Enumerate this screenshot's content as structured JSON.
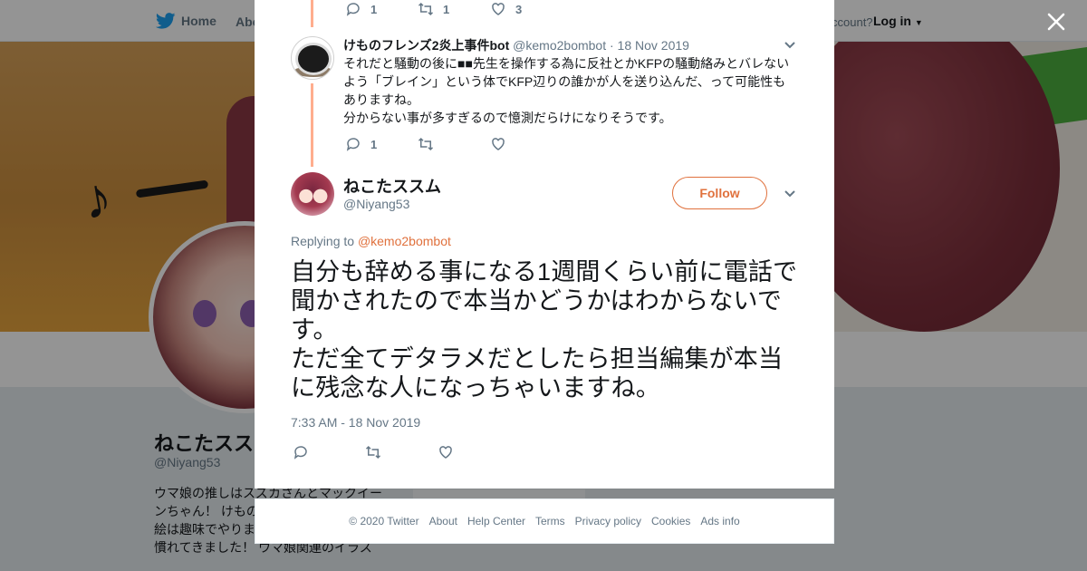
{
  "nav": {
    "home": "Home",
    "about": "Abo",
    "account": "ccount?",
    "login": "Log in"
  },
  "profile": {
    "name": "ねこたスス",
    "handle": "@Niyang53",
    "bio": "ウマ娘の推しはスズカさんとマックイーンちゃん！ けもの ン。元イラストレ め絵は趣味でやります。大分現在の仕事に慣れてきました！ ウマ娘関連のイラス"
  },
  "thread": {
    "top_actions": {
      "reply_count": "1",
      "retweet_count": "1",
      "like_count": "3"
    },
    "reply": {
      "name": "けものフレンズ2炎上事件bot",
      "handle": "@kemo2bombot",
      "date": "· 18 Nov 2019",
      "text": "それだと騒動の後に■■先生を操作する為に反社とかKFPの騒動絡みとバレないよう「ブレイン」という体でKFP辺りの誰かが人を送り込んだ、って可能性もありますね。\n分からない事が多すぎるので憶測だらけになりそうです。",
      "reply_count": "1",
      "retweet_count": "",
      "like_count": ""
    },
    "main": {
      "name": "ねこたススム",
      "handle": "@Niyang53",
      "follow_label": "Follow",
      "replying_label": "Replying to",
      "replying_to": "@kemo2bombot",
      "text": "自分も辞める事になる1週間くらい前に電話で聞かされたので本当かどうかはわからないです。\nただ全てデタラメだとしたら担当編集が本当に残念な人になっちゃいますね。",
      "timestamp": "7:33 AM - 18 Nov 2019"
    }
  },
  "footer": {
    "copyright": "© 2020 Twitter",
    "links": [
      "About",
      "Help Center",
      "Terms",
      "Privacy policy",
      "Cookies",
      "Ads info"
    ]
  },
  "colors": {
    "accent": "#e0713d",
    "thread_line": "#ffad8e",
    "twitter_blue": "#1da1f2",
    "muted": "#657786"
  }
}
